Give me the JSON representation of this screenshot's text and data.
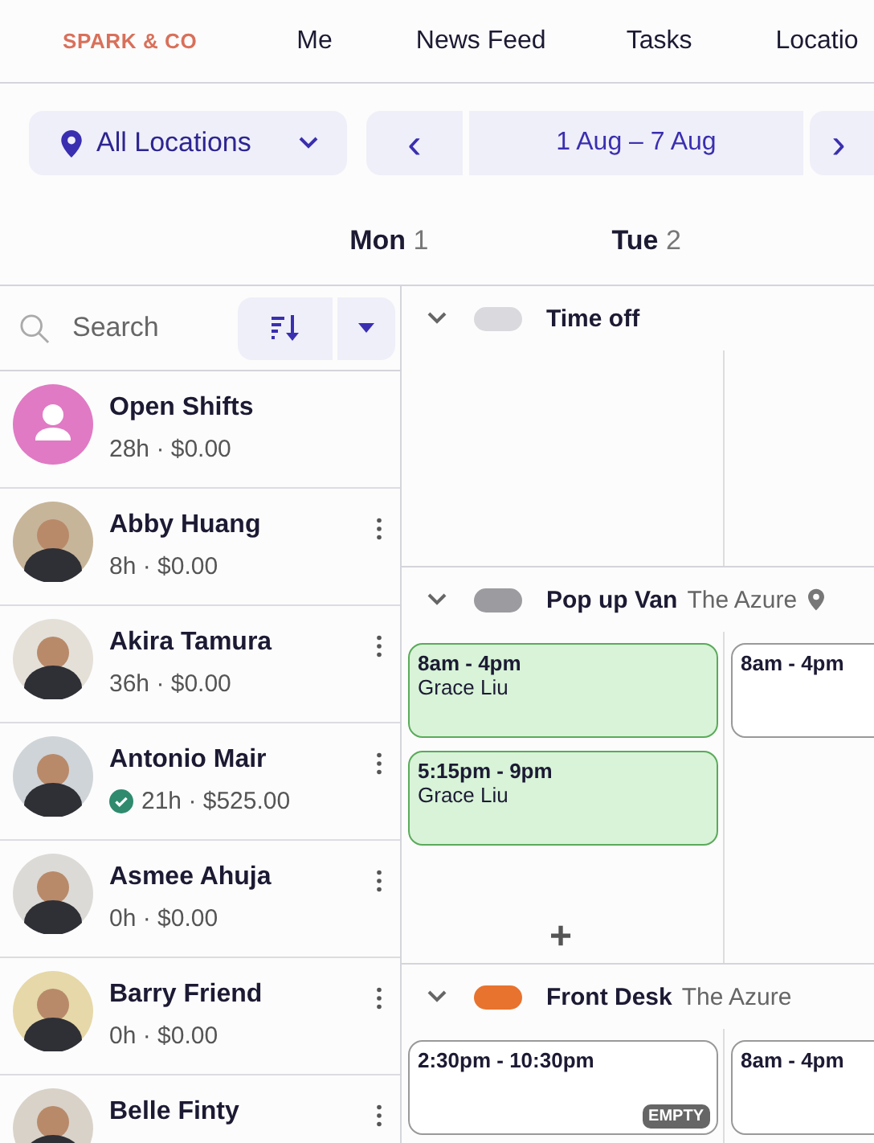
{
  "brand": "SPARK & CO",
  "nav": [
    {
      "label": "Me",
      "selected": false
    },
    {
      "label": "News Feed",
      "selected": false
    },
    {
      "label": "Tasks",
      "selected": false
    },
    {
      "label": "Locatio",
      "selected": false
    }
  ],
  "location_filter": {
    "label": "All Locations"
  },
  "week": {
    "prev": "‹",
    "range": "1 Aug – 7 Aug",
    "next": "›"
  },
  "days": [
    {
      "name": "Mon",
      "date": "1"
    },
    {
      "name": "Tue",
      "date": "2"
    }
  ],
  "search": {
    "placeholder": "Search"
  },
  "people": [
    {
      "kind": "open",
      "name": "Open Shifts",
      "hours": "28h · $0.00",
      "approved": false
    },
    {
      "kind": "person",
      "name": "Abby Huang",
      "hours": "8h · $0.00",
      "approved": false
    },
    {
      "kind": "person",
      "name": "Akira Tamura",
      "hours": "36h · $0.00",
      "approved": false
    },
    {
      "kind": "person",
      "name": "Antonio Mair",
      "hours": "21h · $525.00",
      "approved": true
    },
    {
      "kind": "person",
      "name": "Asmee Ahuja",
      "hours": "0h · $0.00",
      "approved": false
    },
    {
      "kind": "person",
      "name": "Barry Friend",
      "hours": "0h · $0.00",
      "approved": false
    },
    {
      "kind": "person",
      "name": "Belle Finty",
      "approved": false
    }
  ],
  "groups": [
    {
      "name": "Time off",
      "color": "#d9d9de",
      "expanded": true
    },
    {
      "name": "Pop up Van",
      "location": "The Azure",
      "pin": true,
      "color": "#9b9ba0",
      "expanded": true,
      "add": "+",
      "days": [
        [
          {
            "time": "8am - 4pm",
            "person": "Grace Liu",
            "assigned": true
          },
          {
            "time": "5:15pm - 9pm",
            "person": "Grace Liu",
            "assigned": true
          }
        ],
        [
          {
            "time": "8am - 4pm",
            "assigned": false
          }
        ]
      ]
    },
    {
      "name": "Front Desk",
      "location": "The Azure",
      "pin": false,
      "color": "#e8732e",
      "expanded": true,
      "days": [
        [
          {
            "time": "2:30pm - 10:30pm",
            "assigned": false,
            "badge": "EMPTY"
          }
        ],
        [
          {
            "time": "8am - 4pm",
            "assigned": false
          }
        ]
      ]
    }
  ]
}
